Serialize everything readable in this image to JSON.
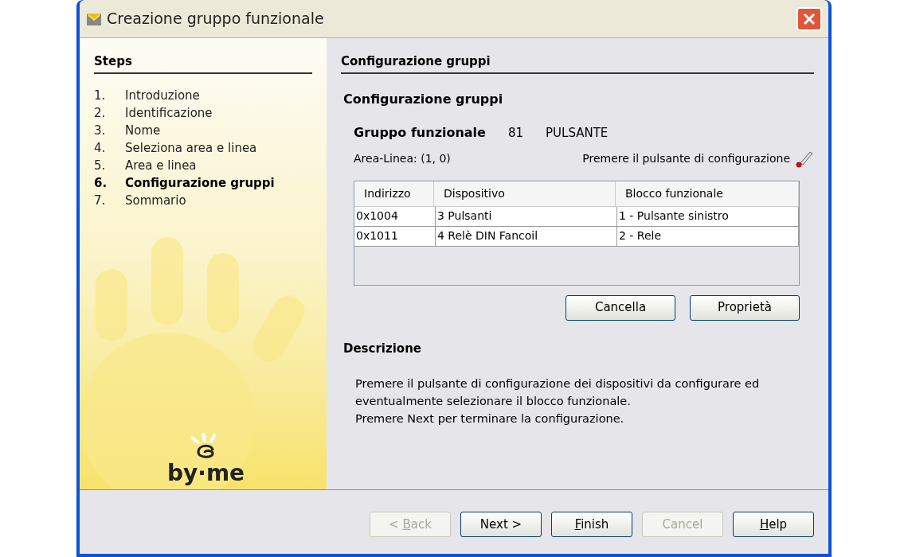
{
  "window": {
    "title": "Creazione gruppo funzionale"
  },
  "steps": {
    "title": "Steps",
    "items": [
      {
        "number": "1.",
        "label": "Introduzione",
        "selected": false
      },
      {
        "number": "2.",
        "label": "Identificazione",
        "selected": false
      },
      {
        "number": "3.",
        "label": "Nome",
        "selected": false
      },
      {
        "number": "4.",
        "label": "Seleziona area e linea",
        "selected": false
      },
      {
        "number": "5.",
        "label": "Area e linea",
        "selected": false
      },
      {
        "number": "6.",
        "label": "Configurazione gruppi",
        "selected": true
      },
      {
        "number": "7.",
        "label": "Sommario",
        "selected": false
      }
    ],
    "logo": "by·me"
  },
  "page": {
    "title": "Configurazione gruppi",
    "section_title": "Configurazione gruppi",
    "group_label": "Gruppo funzionale",
    "group_number": "81",
    "group_name": "PULSANTE",
    "area_line": "Area-Linea: (1, 0)",
    "hint": "Premere il pulsante di configurazione",
    "table": {
      "columns": [
        "Indirizzo",
        "Dispositivo",
        "Blocco funzionale"
      ],
      "rows": [
        [
          "0x1004",
          "3 Pulsanti",
          "1 - Pulsante sinistro"
        ],
        [
          "0x1011",
          "4 Relè DIN Fancoil",
          "2 - Rele"
        ]
      ]
    },
    "table_buttons": [
      "Cancella",
      "Proprietà"
    ],
    "description_title": "Descrizione",
    "description": [
      "Premere il pulsante di configurazione dei dispositivi da configurare ed",
      "eventualmente selezionare il blocco funzionale.",
      "Premere Next per terminare la configurazione."
    ]
  },
  "buttons": [
    {
      "label_start": "< ",
      "mnemonic": "B",
      "label_rest": "ack",
      "disabled": true
    },
    {
      "label_rest": "Next >",
      "disabled": false
    },
    {
      "mnemonic": "F",
      "label_rest": "inish",
      "disabled": false
    },
    {
      "label_rest": "Cancel",
      "disabled": true
    },
    {
      "mnemonic": "H",
      "label_rest": "elp",
      "disabled": false
    }
  ]
}
